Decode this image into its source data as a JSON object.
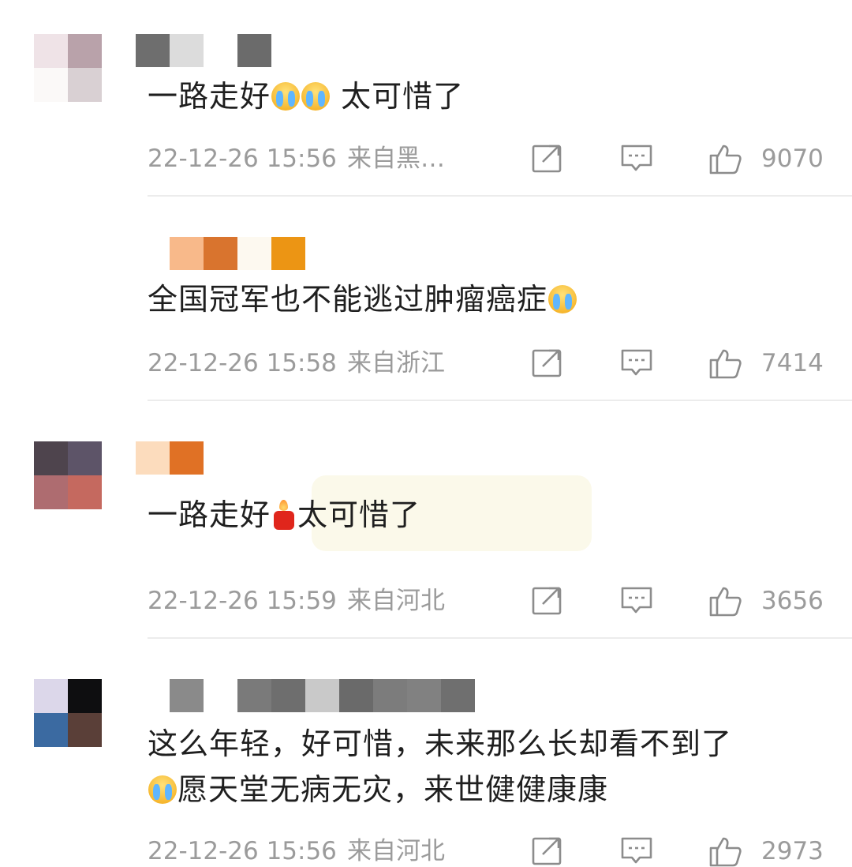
{
  "comments": [
    {
      "text_a": "一路走好",
      "text_b": " 太可惜了",
      "time": "22-12-26 15:56",
      "location": "来自黑…",
      "likes": "9070"
    },
    {
      "text_a": "全国冠军也不能逃过肿瘤癌症",
      "time": "22-12-26 15:58",
      "location": "来自浙江",
      "likes": "7414"
    },
    {
      "text_a": "一路走好",
      "text_b": "太可惜了",
      "time": "22-12-26 15:59",
      "location": "来自河北",
      "likes": "3656"
    },
    {
      "line1": "这么年轻，好可惜，未来那么长却看不到了",
      "line2": "愿天堂无病无灾，来世健健康康",
      "time": "22-12-26 15:56",
      "location": "来自河北",
      "likes": "2973"
    }
  ],
  "icons": {
    "share": "share-icon",
    "reply": "comment-icon",
    "like": "thumbs-up-icon",
    "crying_emoji": "crying-face-emoji",
    "candle_emoji": "candle-emoji"
  },
  "colors": {
    "meta_text": "#9b9b9b",
    "divider": "#ececec",
    "highlight": "#fbf9ea"
  }
}
